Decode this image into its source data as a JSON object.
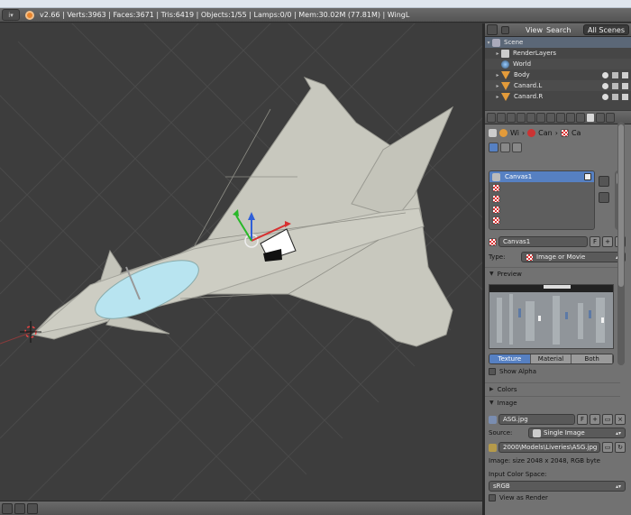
{
  "info": {
    "stats": "v2.66 | Verts:3963 | Faces:3671 | Tris:6419 | Objects:1/55 | Lamps:0/0 | Mem:30.02M (77.81M) | WingL"
  },
  "outliner": {
    "menu_view": "View",
    "menu_search": "Search",
    "scenes_select": "All Scenes",
    "items": [
      {
        "label": "Scene"
      },
      {
        "label": "RenderLayers"
      },
      {
        "label": "World"
      },
      {
        "label": "Body"
      },
      {
        "label": "Canard.L"
      },
      {
        "label": "Canard.R"
      }
    ]
  },
  "properties": {
    "breadcrumb": [
      "Wi",
      "Can",
      "Ca"
    ],
    "texture_slots": [
      {
        "label": "Canvas1",
        "selected": true
      },
      {
        "label": ""
      },
      {
        "label": ""
      },
      {
        "label": ""
      },
      {
        "label": ""
      }
    ],
    "texture_name": "Canvas1",
    "f_label": "F",
    "type_label": "Type:",
    "type_value": "Image or Movie",
    "preview_heading": "Preview",
    "preview_tabs": [
      "Texture",
      "Material",
      "Both"
    ],
    "show_alpha": "Show Alpha",
    "colors_heading": "Colors",
    "image_heading": "Image",
    "image_name": "ASG.jpg",
    "source_label": "Source:",
    "source_value": "Single Image",
    "filepath": "2000\\Models\\Liveries\\ASG.jpg",
    "image_info": "Image: size 2048 x 2048, RGB byte",
    "color_space_label": "Input Color Space:",
    "color_space_value": "sRGB",
    "view_as_render": "View as Render"
  },
  "colors": {
    "texture_tab_active": "#5680c2",
    "canopy": "#b8e4f0",
    "airframe": "#c8c8be"
  }
}
